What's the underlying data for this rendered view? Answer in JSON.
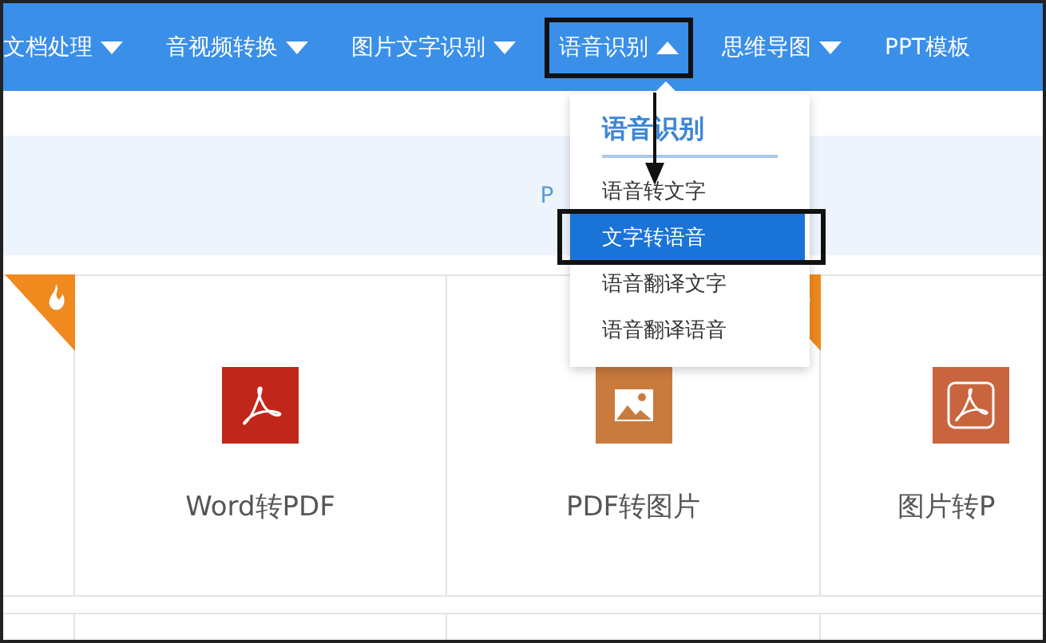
{
  "nav": [
    {
      "label": "文档处理",
      "kind": "menu",
      "expanded": false
    },
    {
      "label": "音视频转换",
      "kind": "menu",
      "expanded": false
    },
    {
      "label": "图片文字识别",
      "kind": "menu",
      "expanded": false
    },
    {
      "label": "语音识别",
      "kind": "menu",
      "expanded": true
    },
    {
      "label": "思维导图",
      "kind": "menu",
      "expanded": false
    },
    {
      "label": "PPT模板",
      "kind": "link",
      "expanded": false
    }
  ],
  "banner": {
    "text": "P"
  },
  "dropdown": {
    "title": "语音识别",
    "items": [
      {
        "label": "语音转文字",
        "selected": false
      },
      {
        "label": "文字转语音",
        "selected": true
      },
      {
        "label": "语音翻译文字",
        "selected": false
      },
      {
        "label": "语音翻译语音",
        "selected": false
      }
    ]
  },
  "cards": [
    {
      "hot": true
    },
    {
      "label": "Word转PDF",
      "kind": "pdf",
      "hot": false
    },
    {
      "label": "PDF转图片",
      "kind": "image",
      "hot": true
    },
    {
      "label": "图片转P",
      "kind": "acrobat",
      "hot": false
    }
  ]
}
